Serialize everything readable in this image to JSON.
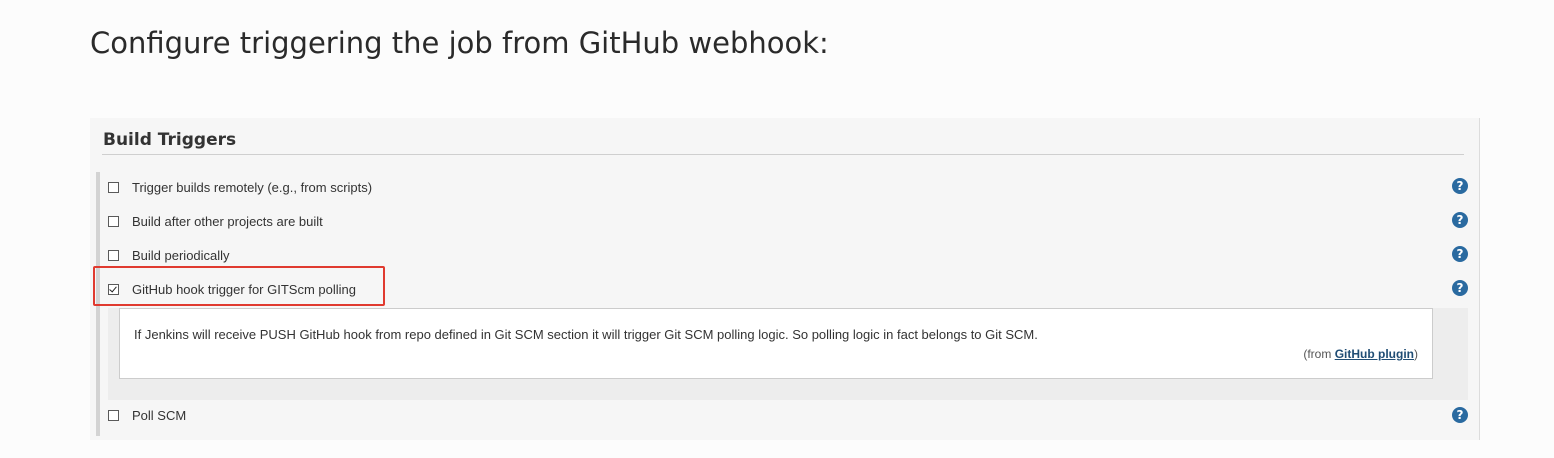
{
  "page": {
    "heading": "Configure triggering the job from GitHub webhook:"
  },
  "section": {
    "title": "Build Triggers"
  },
  "triggers": [
    {
      "label": "Trigger builds remotely (e.g., from scripts)",
      "checked": false
    },
    {
      "label": "Build after other projects are built",
      "checked": false
    },
    {
      "label": "Build periodically",
      "checked": false
    },
    {
      "label": "GitHub hook trigger for GITScm polling",
      "checked": true,
      "highlighted": true
    },
    {
      "label": "Poll SCM",
      "checked": false
    }
  ],
  "help": {
    "icon": "?",
    "text": "If Jenkins will receive PUSH GitHub hook from repo defined in Git SCM section it will trigger Git SCM polling logic. So polling logic in fact belongs to Git SCM.",
    "source_prefix": "(from ",
    "source_link": "GitHub plugin",
    "source_suffix": ")"
  },
  "colors": {
    "highlight": "#e03a2f",
    "help_icon": "#2a6aa0",
    "link": "#204d74"
  }
}
